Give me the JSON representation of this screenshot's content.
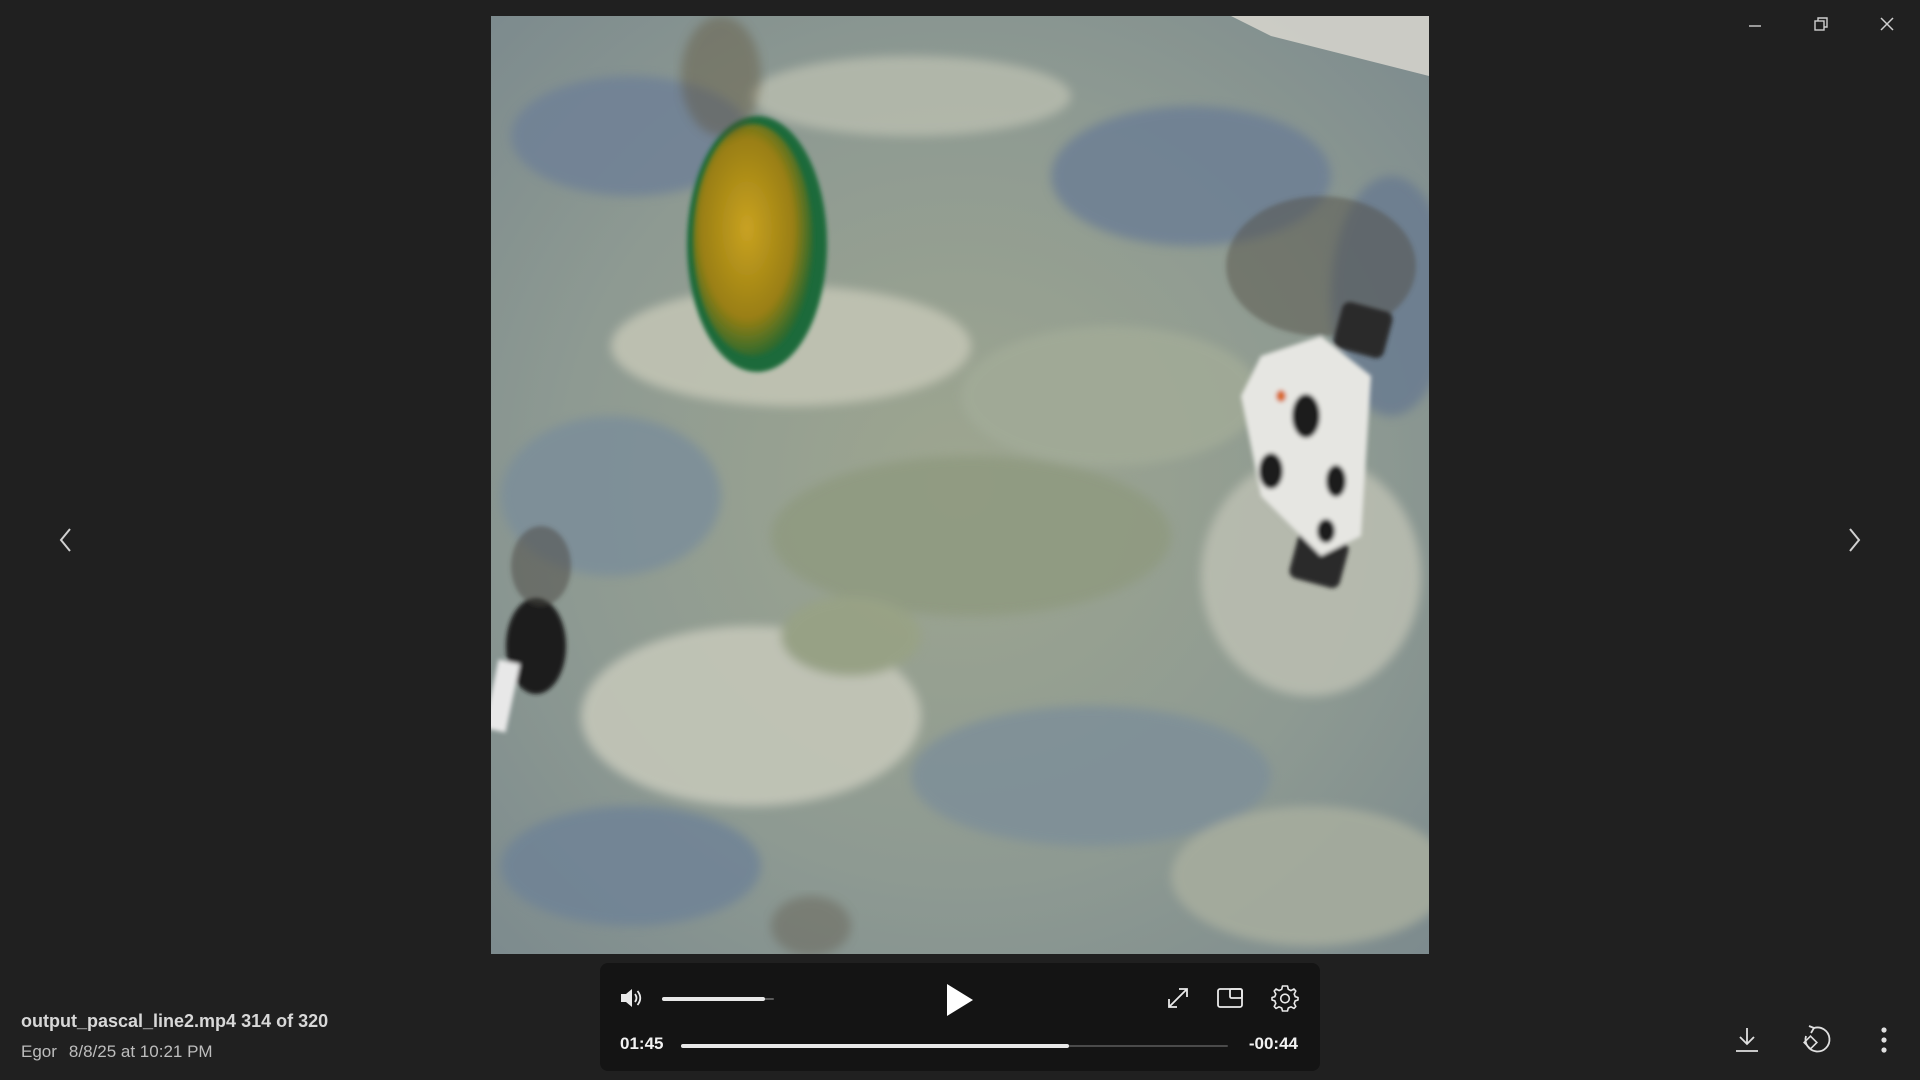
{
  "window": {
    "controls": [
      "minimize-icon",
      "restore-icon",
      "close-icon"
    ]
  },
  "navigation": {
    "previous_icon": "chevron-left-icon",
    "next_icon": "chevron-right-icon"
  },
  "player": {
    "state": "paused",
    "volume_level_fraction": 0.92,
    "time_elapsed": "01:45",
    "time_remaining": "-00:44",
    "progress_fraction": 0.71,
    "icons": {
      "volume": "speaker-icon",
      "play": "play-icon",
      "fullscreen": "expand-icon",
      "pip": "picture-in-picture-icon",
      "settings": "gear-icon"
    }
  },
  "file": {
    "name": "output_pascal_line2.mp4",
    "position": "314 of 320",
    "author": "Egor",
    "date": "8/8/25 at 10:21 PM"
  },
  "actions": {
    "download_icon": "download-icon",
    "rotate_icon": "rotate-icon",
    "more_icon": "more-vertical-icon"
  },
  "colors": {
    "background": "#202020",
    "controls_panel": "#141414",
    "accent": "#e8e8e8"
  }
}
